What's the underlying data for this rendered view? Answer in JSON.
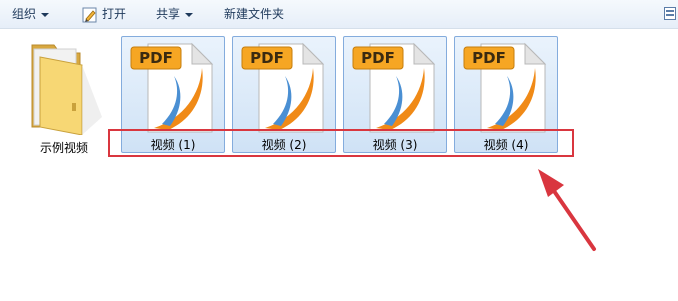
{
  "toolbar": {
    "organize_label": "组织",
    "open_label": "打开",
    "share_label": "共享",
    "new_folder_label": "新建文件夹"
  },
  "folder": {
    "label": "示例视频"
  },
  "files": [
    {
      "label": "视频 (1)",
      "badge": "PDF"
    },
    {
      "label": "视频 (2)",
      "badge": "PDF"
    },
    {
      "label": "视频 (3)",
      "badge": "PDF"
    },
    {
      "label": "视频 (4)",
      "badge": "PDF"
    }
  ],
  "colors": {
    "annotation": "#d9363f",
    "selection_border": "#84acdd",
    "pdf_badge": "#f6a623"
  }
}
